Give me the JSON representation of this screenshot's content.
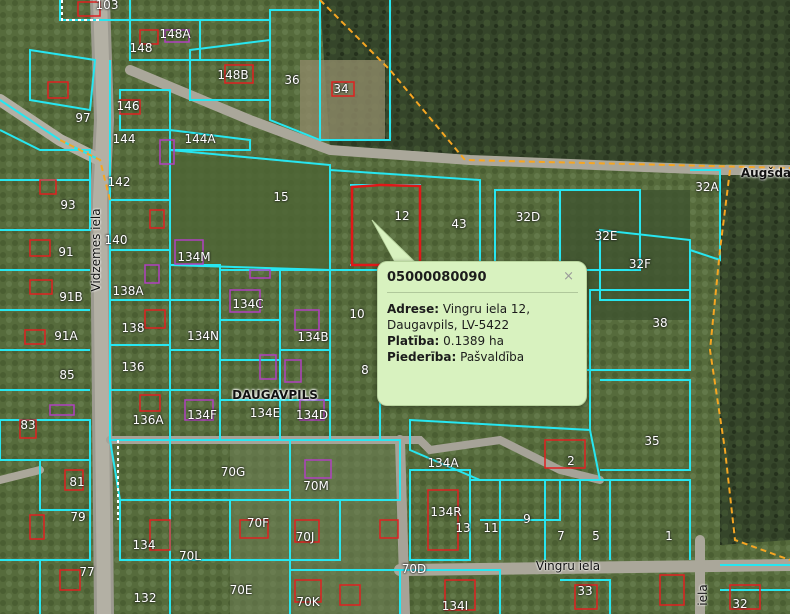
{
  "map": {
    "town": "DAUGAVPILS",
    "street_labels": {
      "vidzemes": "Vidzemes iela",
      "vingru": "Vingru iela",
      "augsdaugavas": "Augšda",
      "right_vertical": "iela"
    },
    "parcel_labels": [
      "103",
      "148",
      "148A",
      "148B",
      "36",
      "34",
      "97",
      "146",
      "144",
      "144A",
      "142",
      "93",
      "140",
      "91",
      "91B",
      "91A",
      "138A",
      "138",
      "136",
      "85",
      "83",
      "81",
      "79",
      "77",
      "15",
      "12",
      "43",
      "32D",
      "32E",
      "32F",
      "38",
      "32A",
      "134M",
      "134C",
      "134B",
      "134N",
      "10",
      "8",
      "136A",
      "134F",
      "134E",
      "134D",
      "35",
      "134A",
      "2",
      "70G",
      "70M",
      "70F",
      "70J",
      "70L",
      "70E",
      "70K",
      "134",
      "132",
      "134R",
      "13",
      "11",
      "9",
      "7",
      "5",
      "1",
      "70D",
      "134I",
      "33",
      "32"
    ]
  },
  "popup": {
    "cadastre_number": "05000080090",
    "close_symbol": "×",
    "fields": [
      {
        "key": "Adrese:",
        "value": "Vingru iela 12, Daugavpils, LV-5422"
      },
      {
        "key": "Platība:",
        "value": "0.1389 ha"
      },
      {
        "key": "Piederība:",
        "value": "Pašvaldība"
      }
    ]
  },
  "colors": {
    "parcel_border": "#27e6f0",
    "highlight_border": "#e01818",
    "boundary": "#f5a623",
    "popup_bg": "#d8f2bf"
  }
}
